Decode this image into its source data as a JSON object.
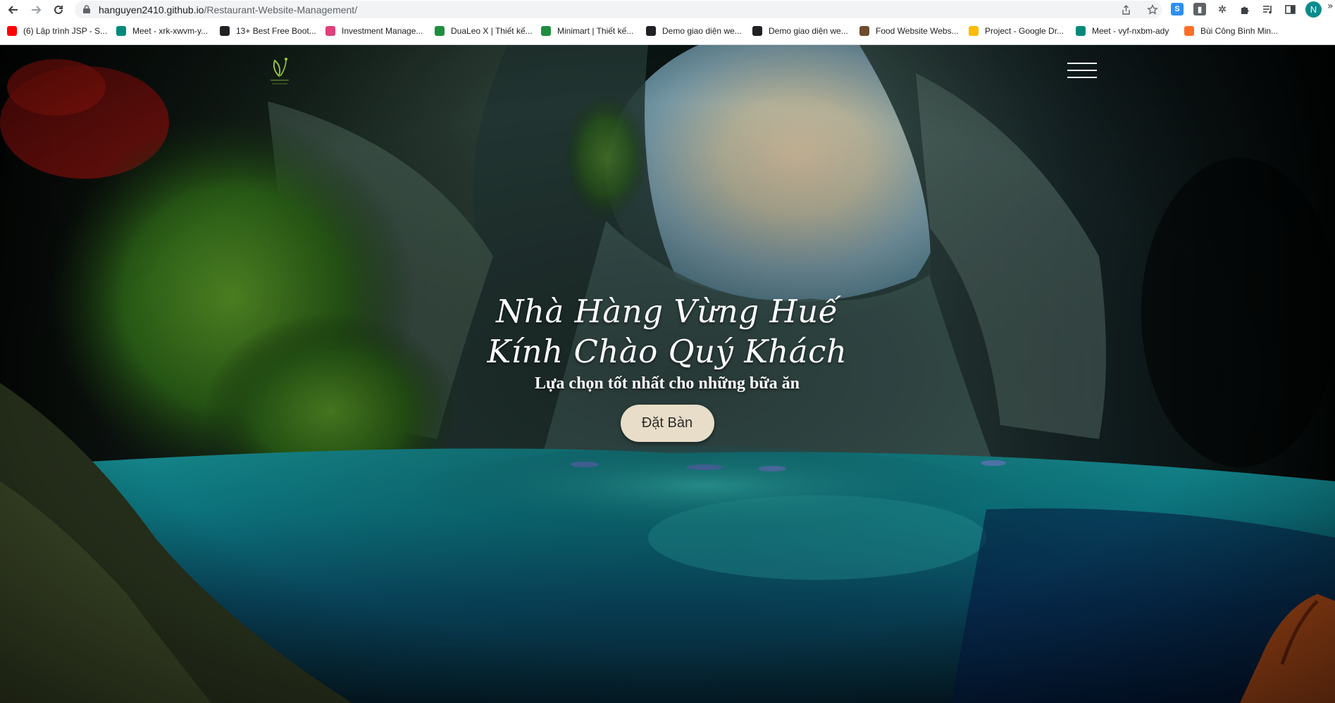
{
  "browser": {
    "url_host": "hanguyen2410.github.io",
    "url_path": "/Restaurant-Website-Management/",
    "profile_initial": "N",
    "icons": {
      "back": "back-arrow-icon",
      "forward": "forward-arrow-icon",
      "reload": "reload-icon",
      "lock": "lock-icon",
      "share": "share-icon",
      "star": "bookmark-star-icon",
      "extensions": "puzzle-icon",
      "sidebar": "side-panel-icon",
      "more": "chevron-right-icon"
    }
  },
  "bookmarks": [
    {
      "label": "(6) Lập trình JSP - S...",
      "color": "#ff0000"
    },
    {
      "label": "Meet - xrk-xwvm-y...",
      "color": "#00897b"
    },
    {
      "label": "13+ Best Free Boot...",
      "color": "#202124"
    },
    {
      "label": "Investment Manage...",
      "color": "#e0407b"
    },
    {
      "label": "DuaLeo X | Thiết kế...",
      "color": "#1e8e3e"
    },
    {
      "label": "Minimart | Thiết kế...",
      "color": "#1e8e3e"
    },
    {
      "label": "Demo giao diện we...",
      "color": "#202124"
    },
    {
      "label": "Demo giao diện we...",
      "color": "#202124"
    },
    {
      "label": "Food Website Webs...",
      "color": "#6d4c2f"
    },
    {
      "label": "Project - Google Dr...",
      "color": "#fbbc04"
    },
    {
      "label": "Meet - vyf-nxbm-ady",
      "color": "#00897b"
    },
    {
      "label": "Bùi Công Bình Min...",
      "color": "#fc6d26"
    }
  ],
  "hero": {
    "title_line1": "Nhà Hàng Vừng Huế",
    "title_line2": "Kính Chào Quý Khách",
    "subtitle": "Lựa chọn tốt nhất cho những bữa ăn",
    "cta_label": "Đặt Bàn",
    "cta_color": "#e7ddc8"
  },
  "header": {
    "logo_icon": "leaf-logo-icon",
    "menu_icon": "hamburger-menu-icon"
  }
}
